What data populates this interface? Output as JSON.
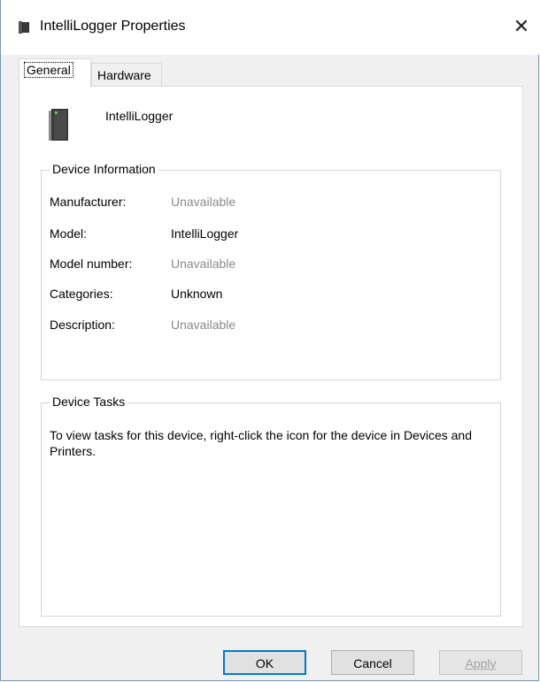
{
  "window": {
    "title": "IntelliLogger Properties",
    "close_symbol": "✕"
  },
  "tabs": [
    {
      "label": "General",
      "active": true
    },
    {
      "label": "Hardware",
      "active": false
    }
  ],
  "device": {
    "name": "IntelliLogger",
    "icon": "device-drive-icon"
  },
  "device_information": {
    "legend": "Device Information",
    "rows": [
      {
        "label": "Manufacturer:",
        "value": "Unavailable"
      },
      {
        "label": "Model:",
        "value": "IntelliLogger"
      },
      {
        "label": "Model number:",
        "value": "Unavailable"
      },
      {
        "label": "Categories:",
        "value": "Unknown"
      },
      {
        "label": "Description:",
        "value": "Unavailable"
      }
    ]
  },
  "device_tasks": {
    "legend": "Device Tasks",
    "text": "To view tasks for this device, right-click the icon for the device in Devices and Printers."
  },
  "buttons": {
    "ok": "OK",
    "cancel": "Cancel",
    "apply": "Apply"
  },
  "colors": {
    "accent": "#0078d7",
    "unavailable_text": "#8a8a8a",
    "device_led": "#3fd23f"
  }
}
